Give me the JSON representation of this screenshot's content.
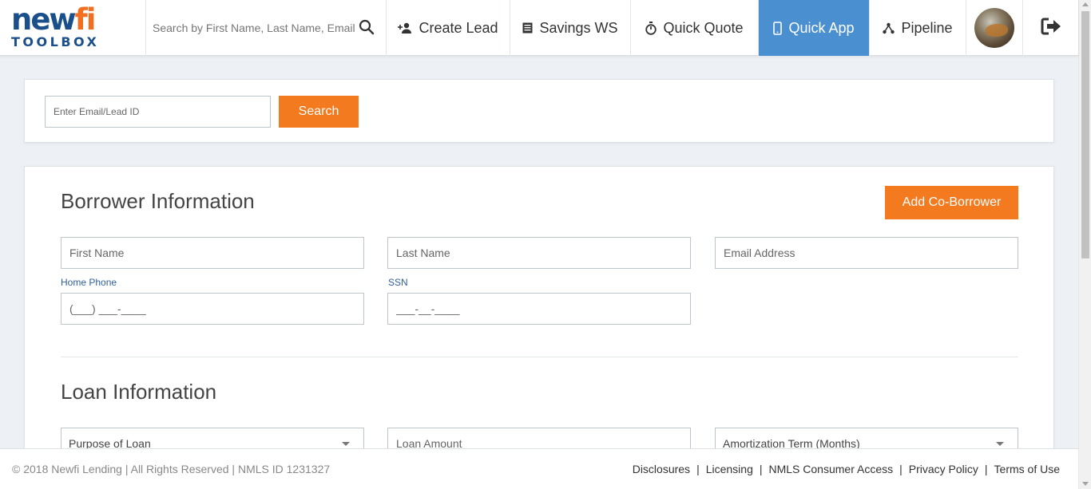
{
  "logo": {
    "top_main": "new",
    "top_accent": "fi",
    "bottom": "TOOLBOX"
  },
  "header_search": {
    "placeholder": "Search by First Name, Last Name, Email"
  },
  "nav": {
    "create_lead": "Create Lead",
    "savings_ws": "Savings WS",
    "quick_quote": "Quick Quote",
    "quick_app": "Quick App",
    "pipeline": "Pipeline"
  },
  "lead_search": {
    "placeholder": "Enter Email/Lead ID",
    "button": "Search"
  },
  "borrower": {
    "title": "Borrower Information",
    "add_co_borrower": "Add Co-Borrower",
    "first_name_placeholder": "First Name",
    "last_name_placeholder": "Last Name",
    "email_placeholder": "Email Address",
    "home_phone_label": "Home Phone",
    "home_phone_mask": "(___) ___-____",
    "ssn_label": "SSN",
    "ssn_mask": "___-__-____"
  },
  "loan": {
    "title": "Loan Information",
    "purpose_value": "Purpose of Loan",
    "amount_placeholder": "Loan Amount",
    "amortization_value": "Amortization Term (Months)"
  },
  "footer": {
    "copyright": "© 2018 Newfi Lending | All Rights Reserved | NMLS ID 1231327",
    "links": [
      "Disclosures",
      "Licensing",
      "NMLS Consumer Access",
      "Privacy Policy",
      "Terms of Use"
    ],
    "separator": "|"
  },
  "colors": {
    "brand_blue": "#1b4f8c",
    "brand_orange": "#f26f21",
    "active_nav": "#4a8fd0",
    "button_orange": "#f47a20"
  },
  "icons": [
    "search-icon",
    "add-person-icon",
    "document-list-icon",
    "stopwatch-icon",
    "mobile-phone-icon",
    "pipeline-icon",
    "logout-icon"
  ]
}
